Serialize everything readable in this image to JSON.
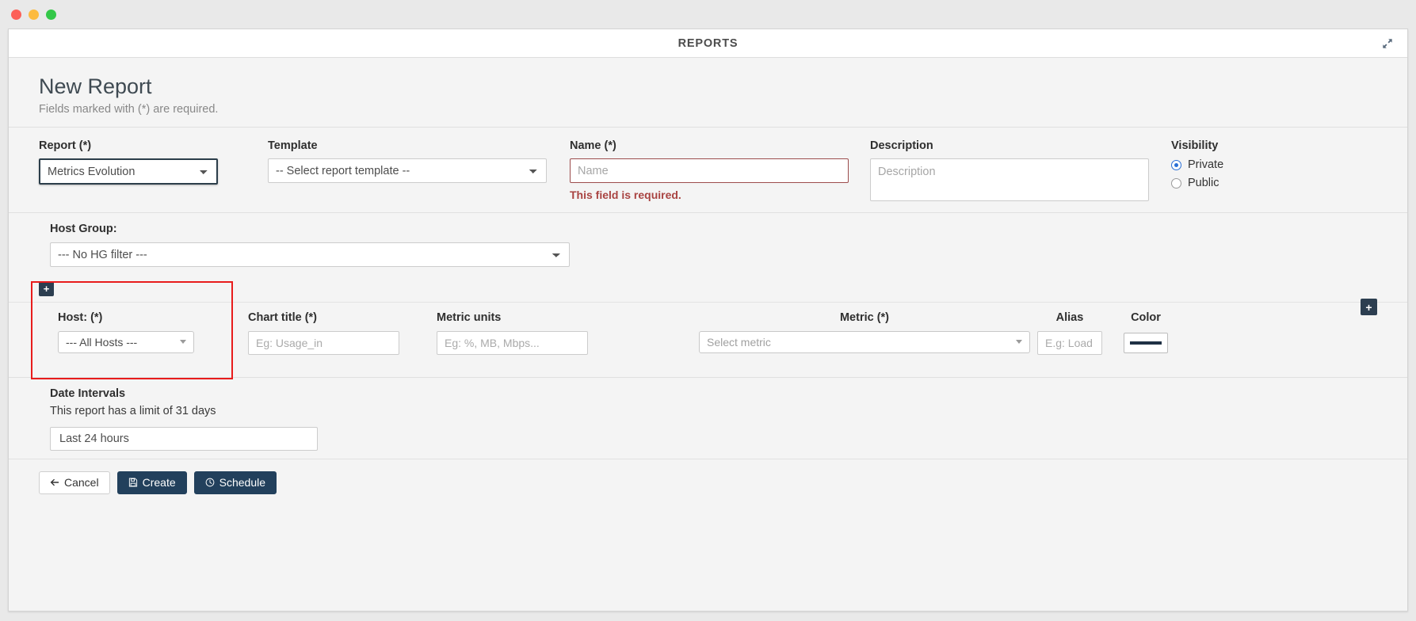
{
  "window": {
    "traffic_lights": [
      "close",
      "minimize",
      "maximize"
    ],
    "app_title": "REPORTS",
    "expand_icon": "expand-diagonal-icon"
  },
  "page": {
    "title": "New Report",
    "subtitle": "Fields marked with (*) are required."
  },
  "form": {
    "report": {
      "label": "Report (*)",
      "value": "Metrics Evolution",
      "focused": true
    },
    "template": {
      "label": "Template",
      "value": "-- Select report template --"
    },
    "name": {
      "label": "Name (*)",
      "value": "",
      "placeholder": "Name",
      "error": "This field is required."
    },
    "description": {
      "label": "Description",
      "value": "",
      "placeholder": "Description"
    },
    "visibility": {
      "label": "Visibility",
      "options": [
        {
          "label": "Private",
          "selected": true
        },
        {
          "label": "Public",
          "selected": false
        }
      ]
    }
  },
  "host_group": {
    "label": "Host Group:",
    "value": "--- No HG filter ---"
  },
  "metrics_panel": {
    "add_row_button": "+",
    "add_metric_button": "+",
    "columns": {
      "host": "Host: (*)",
      "chart_title": "Chart title (*)",
      "metric_units": "Metric units",
      "metric": "Metric (*)",
      "alias": "Alias",
      "color": "Color"
    },
    "row": {
      "host_value": "--- All Hosts ---",
      "chart_title_placeholder": "Eg: Usage_in",
      "chart_title_value": "",
      "metric_units_placeholder": "Eg: %, MB, Mbps...",
      "metric_units_value": "",
      "metric_placeholder": "Select metric",
      "alias_placeholder": "E.g: Load",
      "alias_value": "",
      "color_value": "#1f3044"
    },
    "highlight_color": "#e81c1c"
  },
  "date_intervals": {
    "title": "Date Intervals",
    "note": "This report has a limit of 31 days",
    "value": "Last 24 hours"
  },
  "footer": {
    "cancel": "Cancel",
    "create": "Create",
    "schedule": "Schedule",
    "cancel_icon": "arrow-left-icon",
    "create_icon": "save-icon",
    "schedule_icon": "clock-icon"
  }
}
